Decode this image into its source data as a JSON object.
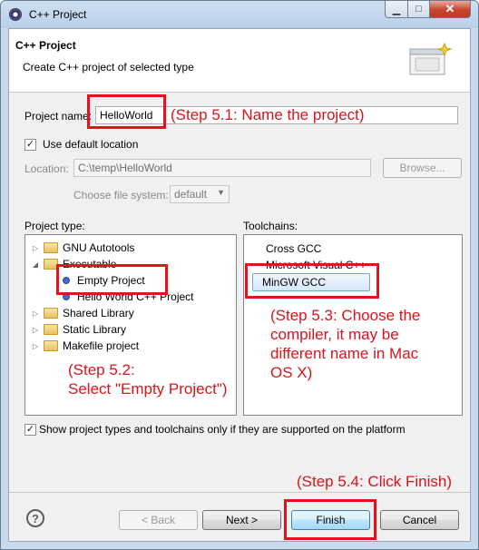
{
  "window": {
    "title": "C++ Project",
    "min": "▁",
    "max": "□",
    "close": "✕"
  },
  "header": {
    "title": "C++ Project",
    "description": "Create C++ project of selected type",
    "icon": "new-project-wizard-icon"
  },
  "project_name": {
    "label": "Project name:",
    "value": "HelloWorld"
  },
  "default_location": {
    "label": "Use default location",
    "checked": true,
    "check": "✓"
  },
  "location": {
    "label": "Location:",
    "value": "C:\\temp\\HelloWorld",
    "browse": "Browse..."
  },
  "file_system": {
    "label": "Choose file system:",
    "value": "default",
    "arrow": "▼"
  },
  "project_type": {
    "label": "Project type:",
    "items": [
      {
        "label": "GNU Autotools",
        "twisty": "▷"
      },
      {
        "label": "Executable",
        "twisty": "◢"
      },
      {
        "label": "Empty Project"
      },
      {
        "label": "Hello World C++ Project"
      },
      {
        "label": "Shared Library",
        "twisty": "▷"
      },
      {
        "label": "Static Library",
        "twisty": "▷"
      },
      {
        "label": "Makefile project",
        "twisty": "▷"
      }
    ]
  },
  "toolchains": {
    "label": "Toolchains:",
    "items": [
      "Cross GCC",
      "Microsoft Visual C++",
      "MinGW GCC"
    ]
  },
  "show_supported": {
    "label": "Show project types and toolchains only if they are supported on the platform",
    "checked": true,
    "check": "✓"
  },
  "buttons": {
    "help": "?",
    "back": "< Back",
    "next": "Next >",
    "finish": "Finish",
    "cancel": "Cancel"
  },
  "annotations": {
    "step_5_1": "(Step 5.1: Name the project)",
    "step_5_2_line1": "(Step 5.2:",
    "step_5_2_line2": "Select \"Empty Project\")",
    "step_5_3_line1": "(Step 5.3: Choose the",
    "step_5_3_line2": "compiler, it may be",
    "step_5_3_line3": "different name in Mac",
    "step_5_3_line4": "OS X)",
    "step_5_4": "(Step 5.4: Click Finish)"
  },
  "colors": {
    "annotation": "#d8141e",
    "titlebar": "#c9d9ec",
    "dialog": "#f0f0f0"
  }
}
